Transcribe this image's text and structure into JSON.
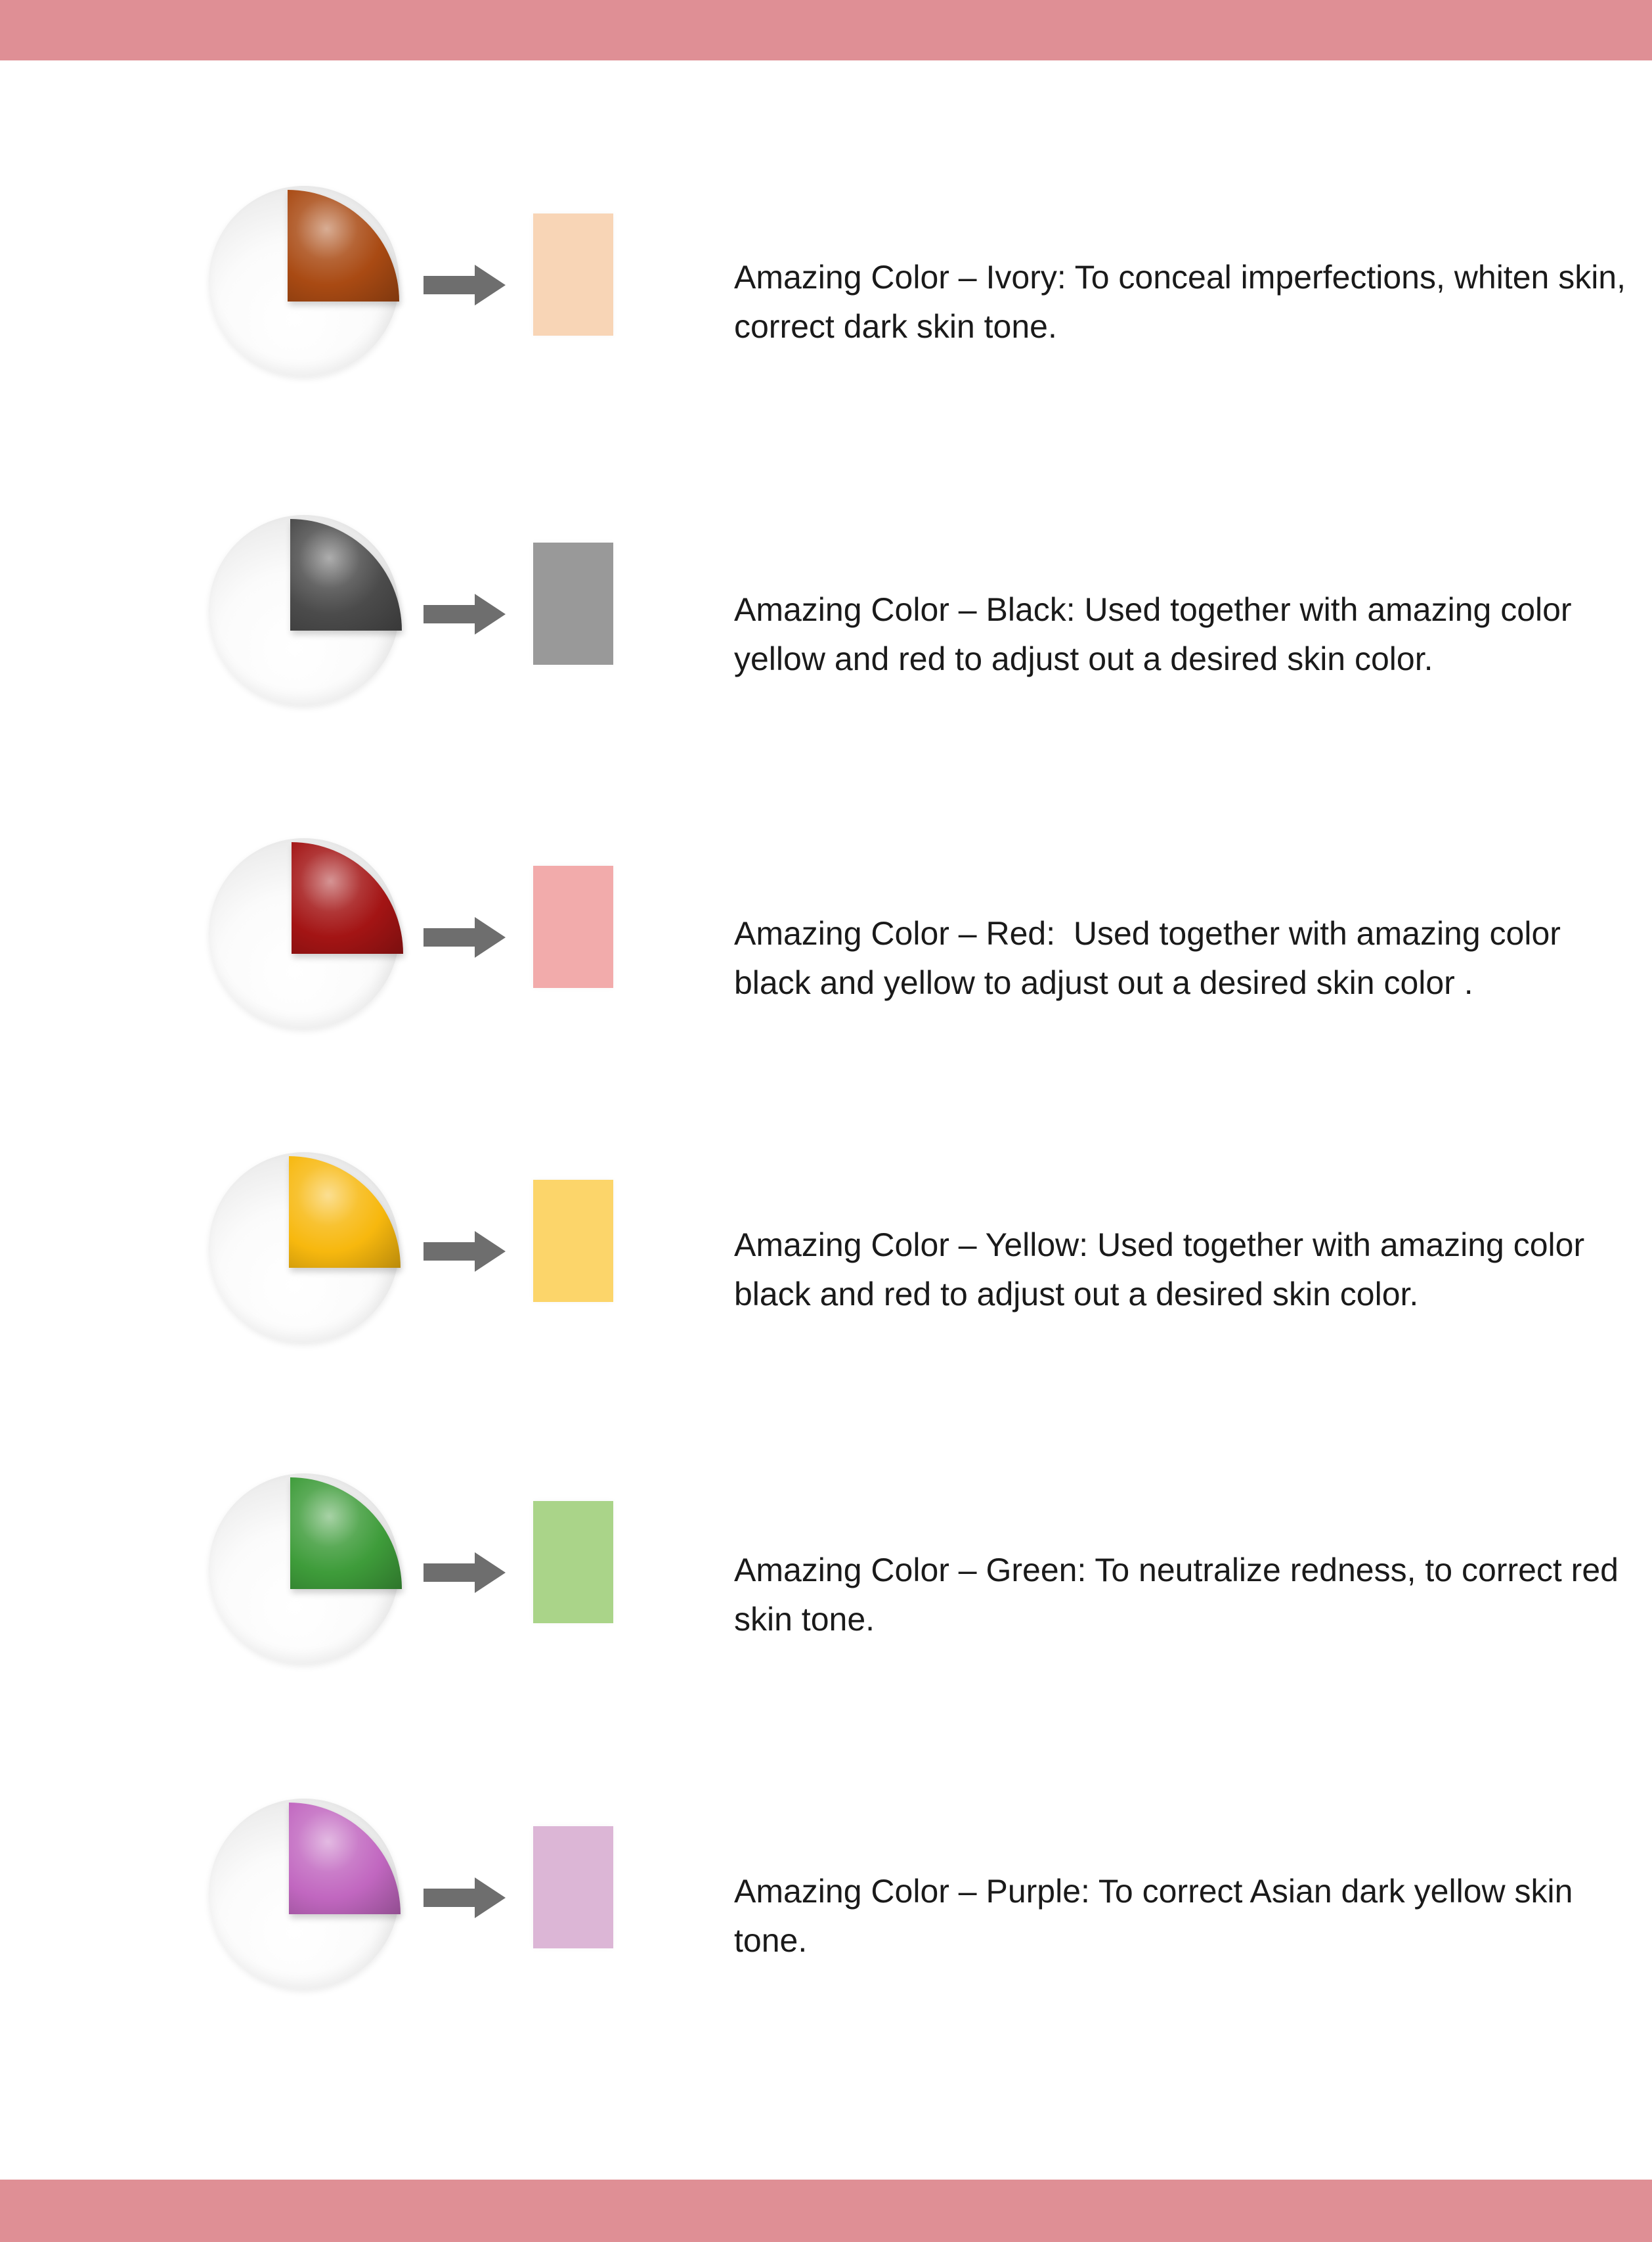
{
  "colors": {
    "band": "#df8f95",
    "arrow": "#6e6e6e"
  },
  "rows": [
    {
      "name": "ivory",
      "description": "Amazing Color – Ivory: To conceal imperfections, whiten skin, correct dark skin tone.",
      "wedge_color": "#a94a13",
      "swatch_color": "#f8d5b6",
      "icon": "ivory-pigment-sphere-icon"
    },
    {
      "name": "black",
      "description": "Amazing Color – Black: Used together with amazing color yellow and red to adjust out a desired skin color.",
      "wedge_color": "#4b4b4b",
      "swatch_color": "#999999",
      "icon": "black-pigment-sphere-icon"
    },
    {
      "name": "red",
      "description": "Amazing Color – Red:  Used together with amazing color black and yellow to adjust out a desired skin color .",
      "wedge_color": "#a31414",
      "swatch_color": "#f2abab",
      "icon": "red-pigment-sphere-icon"
    },
    {
      "name": "yellow",
      "description": "Amazing Color – Yellow: Used together with amazing color black and red to adjust out a desired skin color.",
      "wedge_color": "#f7b80e",
      "swatch_color": "#fcd56a",
      "icon": "yellow-pigment-sphere-icon"
    },
    {
      "name": "green",
      "description": "Amazing Color – Green: To neutralize redness, to correct red skin tone.",
      "wedge_color": "#3e9c3a",
      "swatch_color": "#aad489",
      "icon": "green-pigment-sphere-icon"
    },
    {
      "name": "purple",
      "description": "Amazing Color – Purple: To correct Asian dark yellow skin tone.",
      "wedge_color": "#c167c0",
      "swatch_color": "#dcb6d6",
      "icon": "purple-pigment-sphere-icon"
    }
  ]
}
